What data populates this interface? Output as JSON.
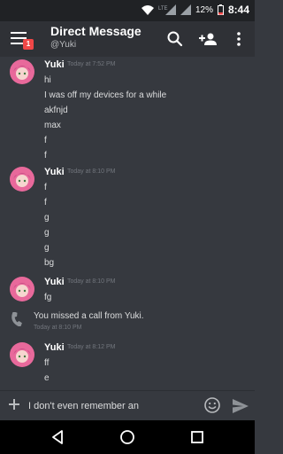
{
  "status_bar": {
    "battery": "12%",
    "time": "8:44"
  },
  "app_bar": {
    "title": "Direct Message",
    "subtitle": "@Yuki",
    "badge": "1"
  },
  "message_groups": [
    {
      "author": "Yuki",
      "timestamp": "Today at 7:52 PM",
      "lines": [
        "hi",
        "I was off my devices for a while",
        "akfnjd",
        "max",
        "f",
        "f"
      ]
    },
    {
      "author": "Yuki",
      "timestamp": "Today at 8:10 PM",
      "lines": [
        "f",
        "f",
        "g",
        "g",
        "g",
        "bg"
      ]
    },
    {
      "author": "Yuki",
      "timestamp": "Today at 8:10 PM",
      "lines": [
        "fg"
      ]
    },
    {
      "author": "Yuki",
      "timestamp": "Today at 8:12 PM",
      "lines": [
        "ff",
        "e"
      ]
    }
  ],
  "missed_call": {
    "text": "You missed a call from Yuki.",
    "timestamp": "Today at 8:10 PM"
  },
  "composer": {
    "value": "I don't even remember an",
    "placeholder": ""
  },
  "icons": {
    "menu": "hamburger-icon",
    "search": "search-icon",
    "add_friend": "add-user-icon",
    "more": "more-vertical-icon",
    "avatar": "avatar-icon",
    "call": "phone-icon",
    "add": "plus-icon",
    "emoji": "emoji-icon",
    "send": "send-icon",
    "nav_back": "back-icon",
    "nav_home": "home-icon",
    "nav_recents": "recents-icon"
  },
  "colors": {
    "background": "#36393f",
    "header": "#2f3136",
    "badge": "#f04747",
    "avatar": "#e8699b"
  }
}
